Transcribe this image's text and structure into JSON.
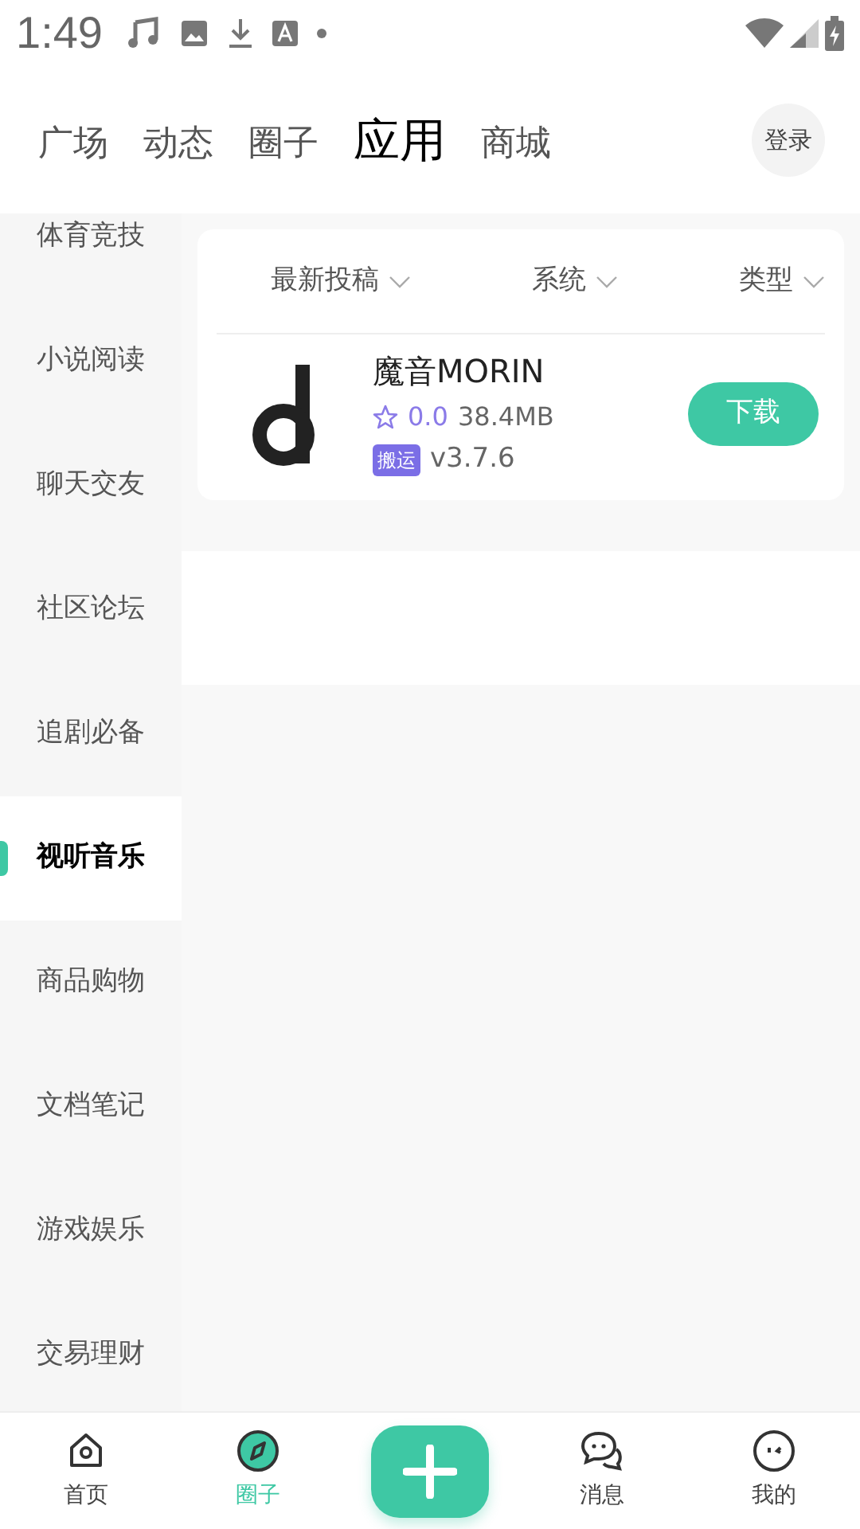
{
  "status_bar": {
    "time": "1:49"
  },
  "tabs": [
    {
      "label": "广场",
      "selected": false
    },
    {
      "label": "动态",
      "selected": false
    },
    {
      "label": "圈子",
      "selected": false
    },
    {
      "label": "应用",
      "selected": true
    },
    {
      "label": "商城",
      "selected": false
    }
  ],
  "login_button": "登录",
  "categories": [
    {
      "label": "体育竞技",
      "selected": false
    },
    {
      "label": "小说阅读",
      "selected": false
    },
    {
      "label": "聊天交友",
      "selected": false
    },
    {
      "label": "社区论坛",
      "selected": false
    },
    {
      "label": "追剧必备",
      "selected": false
    },
    {
      "label": "视听音乐",
      "selected": true
    },
    {
      "label": "商品购物",
      "selected": false
    },
    {
      "label": "文档笔记",
      "selected": false
    },
    {
      "label": "游戏娱乐",
      "selected": false
    },
    {
      "label": "交易理财",
      "selected": false
    }
  ],
  "filters": [
    "最新投稿",
    "系统",
    "类型"
  ],
  "apps": [
    {
      "name": "魔音MORIN",
      "rating": "0.0",
      "size": "38.4MB",
      "tag": "搬运",
      "version": "v3.7.6",
      "action": "下载"
    }
  ],
  "bottom_nav": [
    {
      "kind": "tab",
      "label": "首页",
      "selected": false
    },
    {
      "kind": "tab",
      "label": "圈子",
      "selected": true
    },
    {
      "kind": "add"
    },
    {
      "kind": "tab",
      "label": "消息",
      "selected": false
    },
    {
      "kind": "tab",
      "label": "我的",
      "selected": false
    }
  ]
}
